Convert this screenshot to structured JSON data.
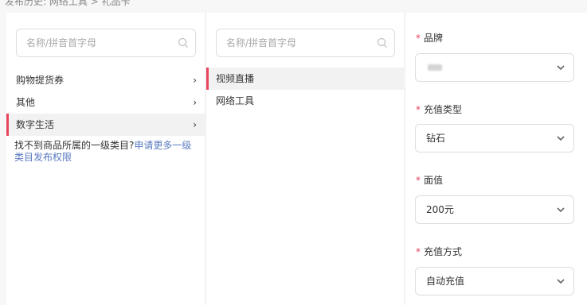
{
  "breadcrumb": "发布历史: 网络工具 > 礼品卡",
  "column1": {
    "search_placeholder": "名称/拼音首字母",
    "items": [
      {
        "label": "购物提货券",
        "chevron": "›"
      },
      {
        "label": "其他",
        "chevron": "›"
      },
      {
        "label": "数字生活",
        "chevron": "›",
        "active": true
      }
    ],
    "notice_text": "找不到商品所属的一级类目?",
    "notice_link": "申请更多一级类目发布权限"
  },
  "column2": {
    "search_placeholder": "名称/拼音首字母",
    "items": [
      {
        "label": "视频直播",
        "active": true
      },
      {
        "label": "网络工具"
      }
    ]
  },
  "form": {
    "required_mark": "*",
    "fields": [
      {
        "label": "品牌",
        "value": ""
      },
      {
        "label": "充值类型",
        "value": "钻石"
      },
      {
        "label": "面值",
        "value": "200元"
      },
      {
        "label": "充值方式",
        "value": "自动充值"
      }
    ]
  },
  "colors": {
    "accent": "#e8445c",
    "link": "#5a7bc0",
    "active_bg": "#f2f2f2"
  },
  "icons": {
    "search": "search-icon",
    "chevron_right": "chevron-right-icon",
    "chevron_down": "chevron-down-icon"
  }
}
